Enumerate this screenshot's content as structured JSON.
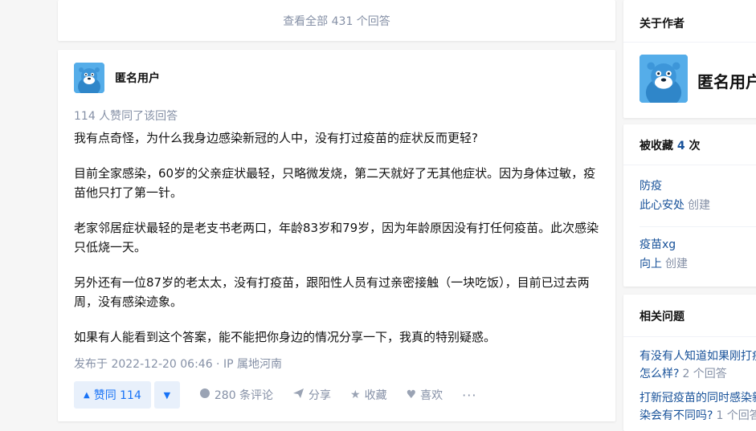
{
  "view_all": {
    "label": "查看全部 431 个回答"
  },
  "answer": {
    "author_name": "匿名用户",
    "vote_text": "114 人赞同了该回答",
    "paragraphs": [
      "我有点奇怪，为什么我身边感染新冠的人中，没有打过疫苗的症状反而更轻?",
      "目前全家感染，60岁的父亲症状最轻，只略微发烧，第二天就好了无其他症状。因为身体过敏，疫苗他只打了第一针。",
      "老家邻居症状最轻的是老支书老两口，年龄83岁和79岁，因为年龄原因没有打任何疫苗。此次感染只低烧一天。",
      "另外还有一位87岁的老太太，没有打疫苗，跟阳性人员有过亲密接触（一块吃饭），目前已过去两周，没有感染迹象。",
      "如果有人能看到这个答案，能不能把你身边的情况分享一下，我真的特别疑惑。"
    ],
    "meta": "发布于 2022-12-20 06:46 · IP 属地河南",
    "actions": {
      "upvote_label": "赞同 114",
      "comments_label": "280 条评论",
      "share_label": "分享",
      "collect_label": "收藏",
      "like_label": "喜欢",
      "more_label": "···"
    }
  },
  "sidebar": {
    "about": {
      "title": "关于作者",
      "author_name": "匿名用户"
    },
    "favorites": {
      "title_prefix": "被收藏",
      "count": "4",
      "title_suffix": "次",
      "items": [
        {
          "name": "防疫",
          "creator": "此心安处",
          "creator_suffix": "创建"
        },
        {
          "name": "疫苗xg",
          "creator": "向上",
          "creator_suffix": "创建"
        }
      ]
    },
    "related": {
      "title": "相关问题",
      "items": [
        {
          "line1": "有没有人知道如果刚打疫",
          "line2": "怎么样?",
          "count": "2 个回答"
        },
        {
          "line1": "打新冠疫苗的同时感染新",
          "line2": "染会有不同吗?",
          "count": "1 个回答"
        }
      ]
    }
  },
  "colors": {
    "brand_blue": "#1772f6",
    "link_blue": "#175199",
    "muted": "#8590a6"
  }
}
